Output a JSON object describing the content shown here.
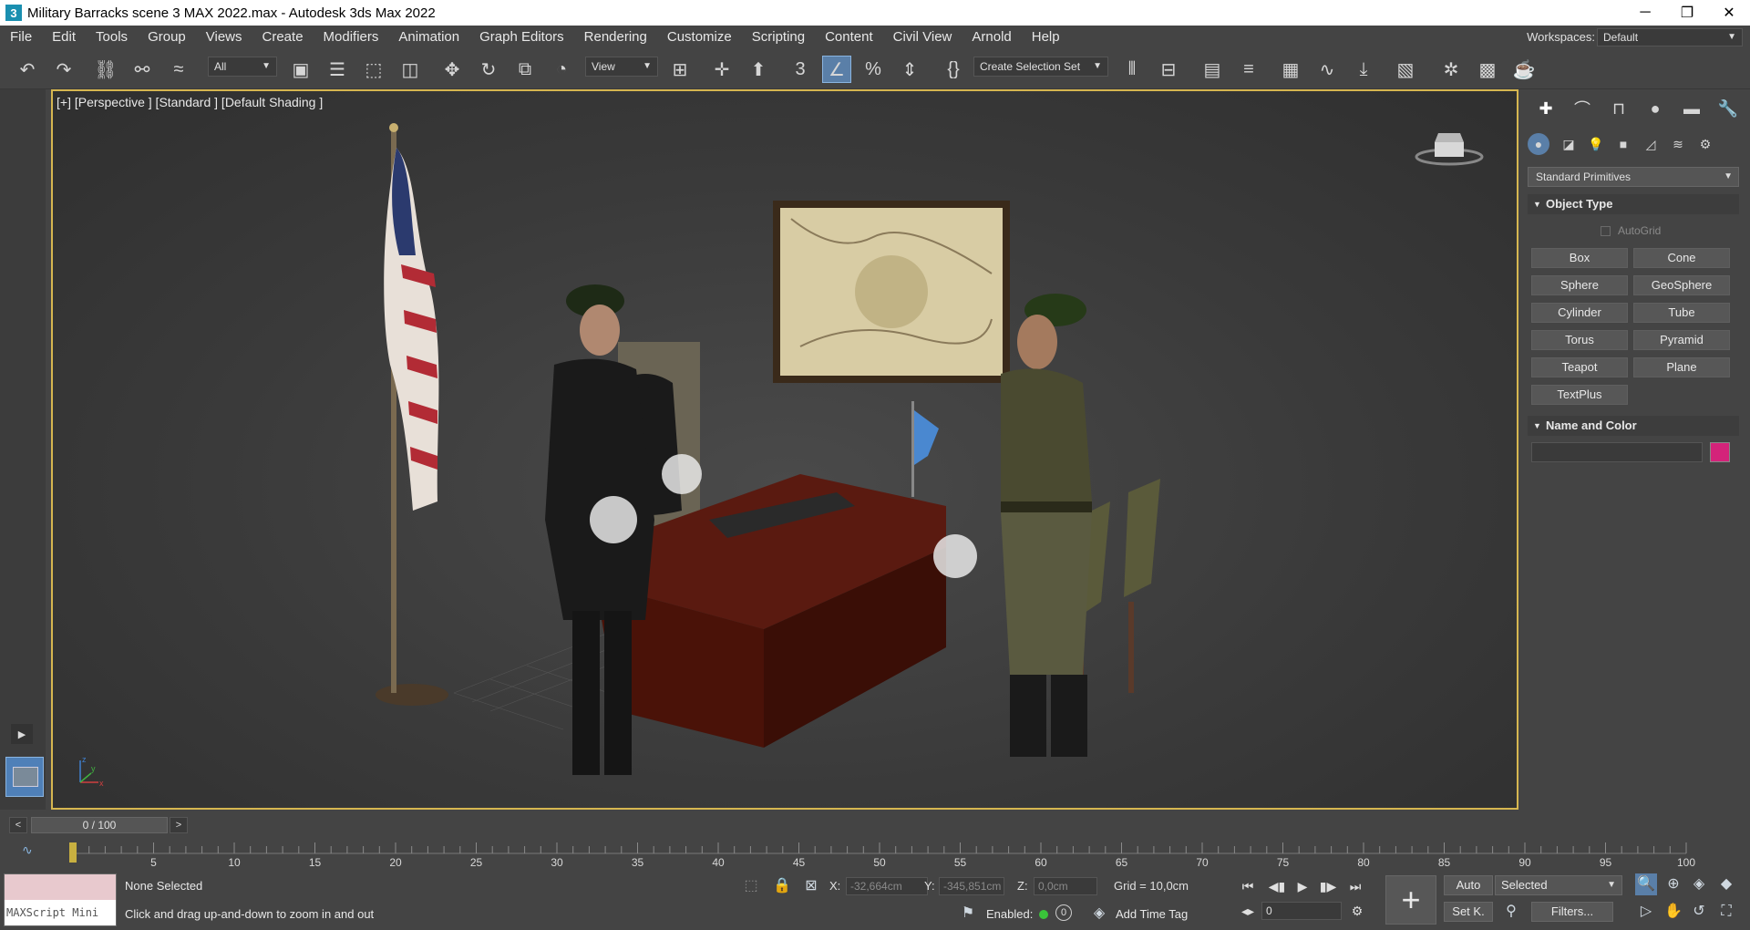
{
  "titlebar": {
    "app_icon": "3",
    "title": "Military Barracks scene 3 MAX 2022.max - Autodesk 3ds Max 2022",
    "minimize": "─",
    "restore": "❐",
    "close": "✕"
  },
  "menubar": {
    "items": [
      "File",
      "Edit",
      "Tools",
      "Group",
      "Views",
      "Create",
      "Modifiers",
      "Animation",
      "Graph Editors",
      "Rendering",
      "Customize",
      "Scripting",
      "Content",
      "Civil View",
      "Arnold",
      "Help"
    ],
    "workspaces_label": "Workspaces:",
    "workspace_value": "Default"
  },
  "toolbar": {
    "filter_value": "All",
    "refcoord_value": "View",
    "selection_set_value": "Create Selection Set",
    "icons": [
      "undo-icon",
      "redo-icon",
      "link-icon",
      "unlink-icon",
      "bind-spacewarp-icon",
      "select-object-icon",
      "select-by-name-icon",
      "rect-region-icon",
      "window-crossing-icon",
      "move-icon",
      "rotate-icon",
      "scale-icon",
      "placement-icon",
      "pivot-icon",
      "mirror-icon",
      "snap-3d-icon",
      "angle-snap-icon",
      "percent-snap-icon",
      "spinner-snap-icon",
      "named-selection-icon",
      "align-icon",
      "layer-explorer-icon",
      "ribbon-icon",
      "curve-editor-icon",
      "schematic-view-icon",
      "material-editor-icon",
      "render-setup-icon",
      "rendered-frame-icon",
      "render-icon"
    ]
  },
  "viewport": {
    "label": "[+] [Perspective ] [Standard ] [Default Shading ]",
    "axis_x": "x",
    "axis_y": "y",
    "axis_z": "z"
  },
  "command_panel": {
    "tabs": [
      "create-tab-icon",
      "modify-tab-icon",
      "hierarchy-tab-icon",
      "motion-tab-icon",
      "display-tab-icon",
      "utilities-tab-icon"
    ],
    "subtabs": [
      "geometry-icon",
      "shapes-icon",
      "lights-icon",
      "cameras-icon",
      "helpers-icon",
      "spacewarps-icon",
      "systems-icon"
    ],
    "category": "Standard Primitives",
    "object_type_title": "Object Type",
    "autogrid_label": "AutoGrid",
    "object_buttons": [
      "Box",
      "Cone",
      "Sphere",
      "GeoSphere",
      "Cylinder",
      "Tube",
      "Torus",
      "Pyramid",
      "Teapot",
      "Plane",
      "TextPlus"
    ],
    "name_color_title": "Name and Color",
    "color_hex": "#d4237a"
  },
  "timeslider": {
    "prev": "<",
    "next": ">",
    "frame_display": "0 / 100"
  },
  "trackbar": {
    "ticks": [
      5,
      10,
      15,
      20,
      25,
      30,
      35,
      40,
      45,
      50,
      55,
      60,
      65,
      70,
      75,
      80,
      85,
      90,
      95,
      100
    ]
  },
  "status": {
    "maxscript_label": "MAXScript Mini",
    "selection": "None Selected",
    "prompt": "Click and drag up-and-down to zoom in and out",
    "x_label": "X:",
    "x_value": "-32,664cm",
    "y_label": "Y:",
    "y_value": "-345,851cm",
    "z_label": "Z:",
    "z_value": "0,0cm",
    "grid": "Grid = 10,0cm",
    "enabled_label": "Enabled:",
    "enabled_count": "0",
    "add_time_tag": "Add Time Tag",
    "auto_key": "Auto",
    "set_key": "Set K.",
    "selected_dd": "Selected",
    "filters": "Filters...",
    "current_frame": "0"
  }
}
